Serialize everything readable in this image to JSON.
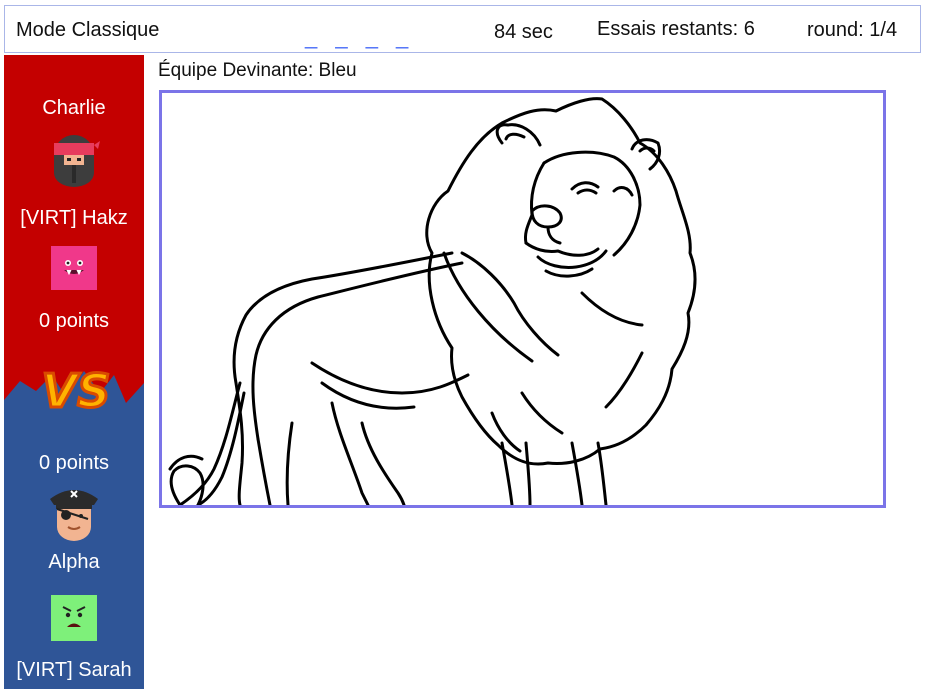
{
  "header": {
    "mode": "Mode Classique",
    "word_hint": "_ _ _ _",
    "timer": "84 sec",
    "tries": "Essais restants: 6",
    "round": "round: 1/4"
  },
  "red_team": {
    "color": "#c40000",
    "players": [
      {
        "name": "Charlie",
        "avatar": "ninja-avatar"
      },
      {
        "name": "[VIRT] Hakz",
        "avatar": "pink-monster-avatar"
      }
    ],
    "points": "0 points"
  },
  "versus": "VS",
  "blue_team": {
    "color": "#2f5597",
    "points": "0 points",
    "players": [
      {
        "name": "Alpha",
        "avatar": "pirate-avatar"
      },
      {
        "name": "[VIRT] Sarah",
        "avatar": "green-monster-avatar"
      }
    ]
  },
  "main": {
    "guessing_team": "Équipe Devinante: Bleu",
    "drawing": "lion-sketch"
  }
}
